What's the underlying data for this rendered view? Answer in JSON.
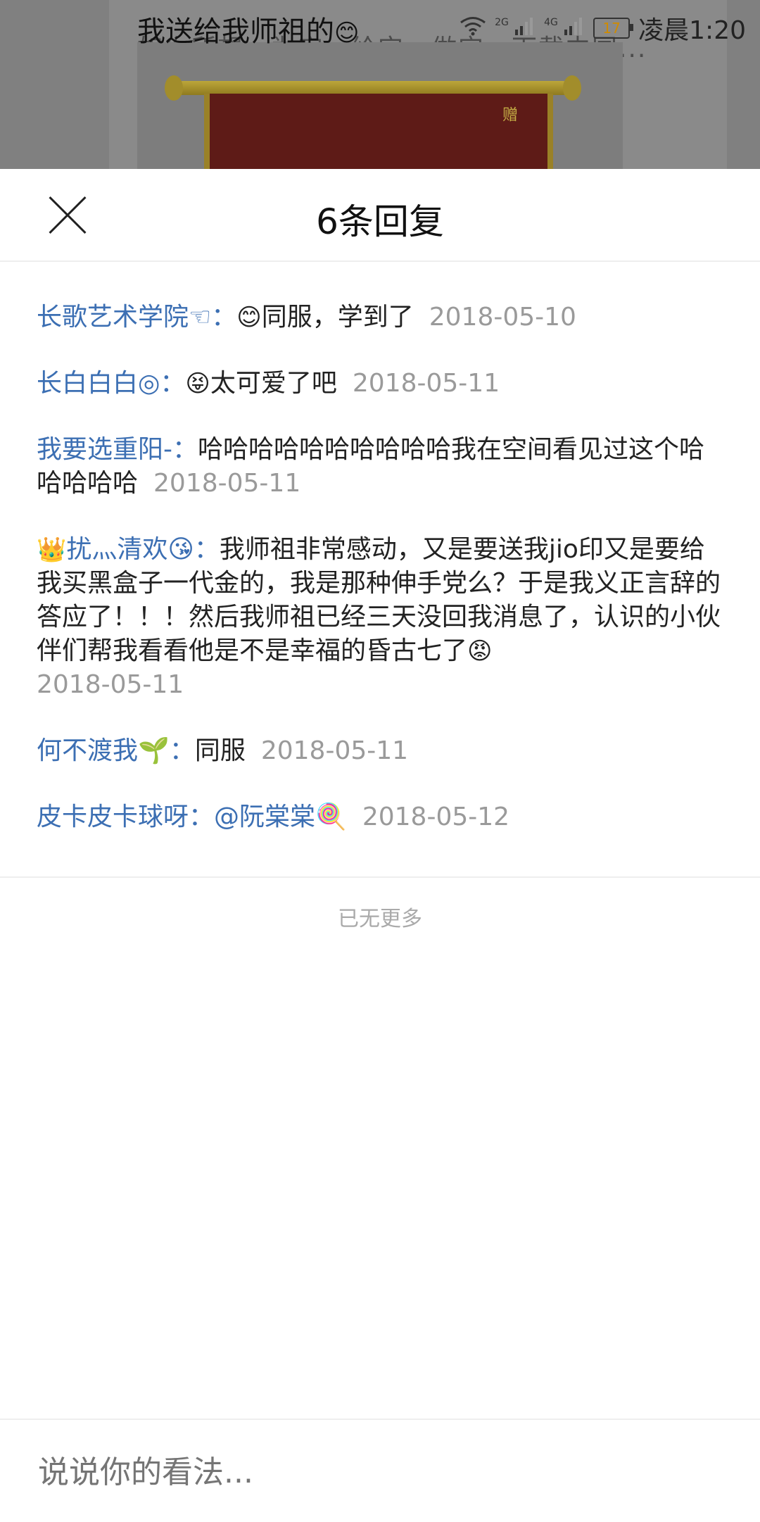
{
  "status_bar": {
    "post_title": "我送给我师祖的",
    "post_title_emoji": "😊",
    "network_2g": "2G",
    "network_4g": "4G",
    "battery": "17",
    "time": "凌晨1:20"
  },
  "background": {
    "overlay_text": "如你所想，为它，给它，做它，下载中国...",
    "pennant_text": "赠"
  },
  "sheet": {
    "title": "6条回复",
    "replies": [
      {
        "user": "长歌艺术学院☜：",
        "emoji": "😊",
        "text": "同服，学到了",
        "date": "2018-05-10"
      },
      {
        "user": "长白白白◎：",
        "emoji": "😝",
        "text": "太可爱了吧",
        "date": "2018-05-11"
      },
      {
        "user": "我要选重阳-：",
        "emoji": "",
        "text": "哈哈哈哈哈哈哈哈哈哈我在空间看见过这个哈哈哈哈哈",
        "date": "2018-05-11"
      },
      {
        "user_prefix": "👑",
        "user": "扰灬清欢",
        "user_suffix": "😘：",
        "text": "我师祖非常感动，又是要送我jio印又是要给我买黑盒子一代金的，我是那种伸手党么？于是我义正言辞的答应了！！！然后我师祖已经三天没回我消息了，认识的小伙伴们帮我看看他是不是幸福的昏古七了",
        "text_emoji": "😡",
        "date": "2018-05-11"
      },
      {
        "user": "何不渡我🌱：",
        "emoji": "",
        "text": "同服",
        "date": "2018-05-11"
      },
      {
        "user": "皮卡皮卡球呀：",
        "emoji": "",
        "text": "@阮棠棠🍭",
        "date": "2018-05-12"
      }
    ],
    "no_more": "已无更多",
    "comment_placeholder": "说说你的看法..."
  }
}
